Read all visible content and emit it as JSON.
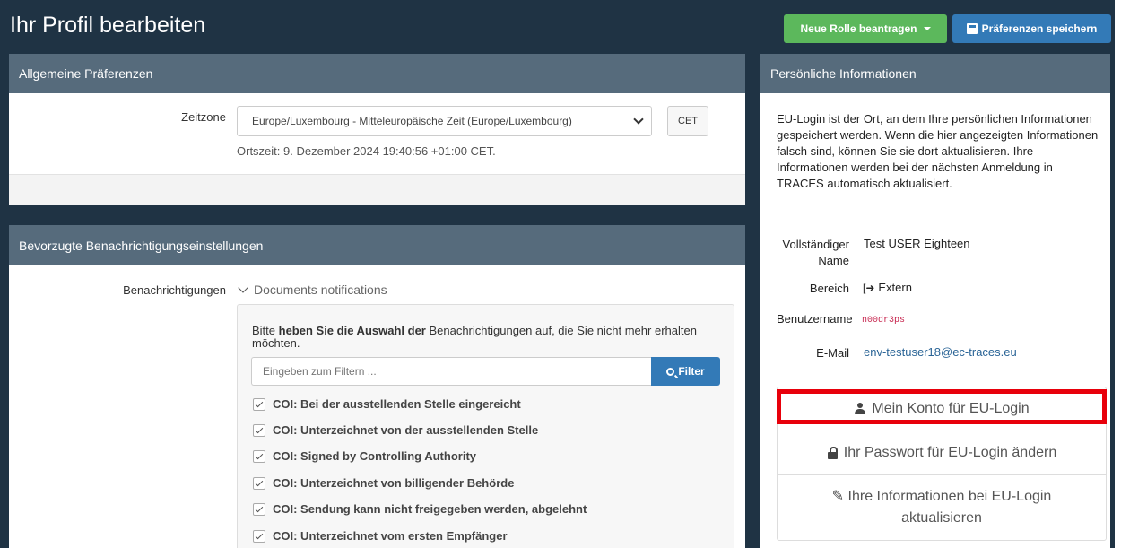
{
  "header": {
    "title": "Ihr Profil bearbeiten",
    "new_role_label": "Neue Rolle beantragen",
    "save_prefs_label": "Präferenzen speichern"
  },
  "general_prefs": {
    "title": "Allgemeine Präferenzen",
    "timezone_label": "Zeitzone",
    "timezone_value": "Europe/Luxembourg - Mitteleuropäische Zeit (Europe/Luxembourg)",
    "tz_abbrev": "CET",
    "local_time_prefix": "Ortszeit: ",
    "local_time_value": "9. Dezember 2024 19:40:56 +01:00 CET."
  },
  "notifications": {
    "title": "Bevorzugte Benachrichtigungseinstellungen",
    "label": "Benachrichtigungen",
    "group_toggle": "Documents notifications",
    "intro_a": "Bitte ",
    "intro_b": "heben Sie die Auswahl der",
    "intro_c": " Benachrichtigungen auf, die Sie nicht mehr erhalten möchten.",
    "filter_placeholder": "Eingeben zum Filtern ...",
    "filter_button": "Filter",
    "items": [
      "COI: Bei der ausstellenden Stelle eingereicht",
      "COI: Unterzeichnet von der ausstellenden Stelle",
      "COI: Signed by Controlling Authority",
      "COI: Unterzeichnet von billigender Behörde",
      "COI: Sendung kann nicht freigegeben werden, abgelehnt",
      "COI: Unterzeichnet vom ersten Empfänger"
    ]
  },
  "personal_info": {
    "title": "Persönliche Informationen",
    "description": "EU-Login ist der Ort, an dem Ihre persönlichen Informationen gespeichert werden. Wenn die hier angezeigten Informationen falsch sind, können Sie sie dort aktualisieren. Ihre Informationen werden bei der nächsten Anmeldung in TRACES automatisch aktualisiert.",
    "full_name_label_1": "Vollständiger",
    "full_name_label_2": "Name",
    "full_name_value": "Test USER Eighteen",
    "area_label": "Bereich",
    "area_value": "Extern",
    "username_label": "Benutzername",
    "username_value": "n00dr3ps",
    "email_label": "E-Mail",
    "email_value": "env-testuser18@ec-traces.eu",
    "link_account": "Mein Konto für EU-Login",
    "link_password": "Ihr Passwort für EU-Login ändern",
    "link_update_1": "Ihre Informationen bei EU-Login",
    "link_update_2": "aktualisieren"
  },
  "colors": {
    "header_bg": "#1f3344",
    "panel_head": "#566b7c",
    "green_button": "#5cb85c",
    "blue_button": "#337ab7",
    "highlight": "#e8000b"
  }
}
